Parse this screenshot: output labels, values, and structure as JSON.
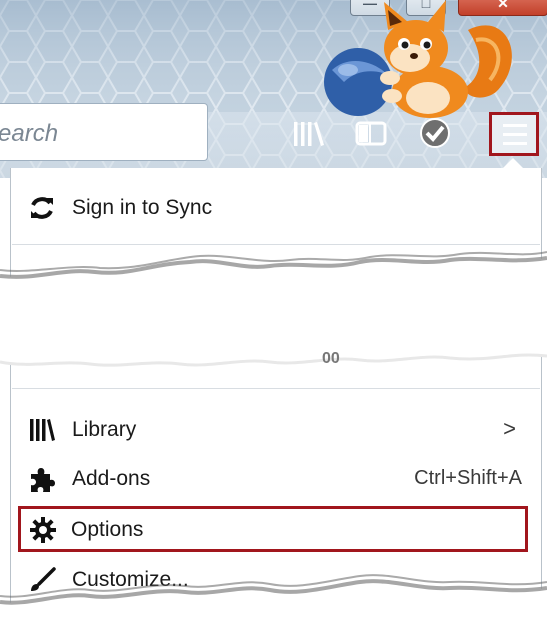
{
  "window_controls": {
    "minimize": "—",
    "maximize": "□",
    "close": "✕"
  },
  "toolbar": {
    "search_placeholder": "Search",
    "icons": [
      "library-icon",
      "sidebar-icon",
      "check-icon",
      "hamburger-menu-icon"
    ]
  },
  "menu": {
    "sync": {
      "label": "Sign in to Sync",
      "icon": "sync-icon"
    },
    "library": {
      "label": "Library",
      "icon": "library-icon",
      "chevron": ">"
    },
    "addons": {
      "label": "Add-ons",
      "shortcut": "Ctrl+Shift+A",
      "icon": "puzzle-icon"
    },
    "options": {
      "label": "Options",
      "icon": "gear-icon",
      "highlight_color": "#a1161d"
    },
    "customize": {
      "label": "Customize...",
      "icon": "brush-icon"
    }
  },
  "partial_text": "00",
  "colors": {
    "highlight": "#a1161d",
    "toolbar_bg": "#c9d7e3"
  }
}
